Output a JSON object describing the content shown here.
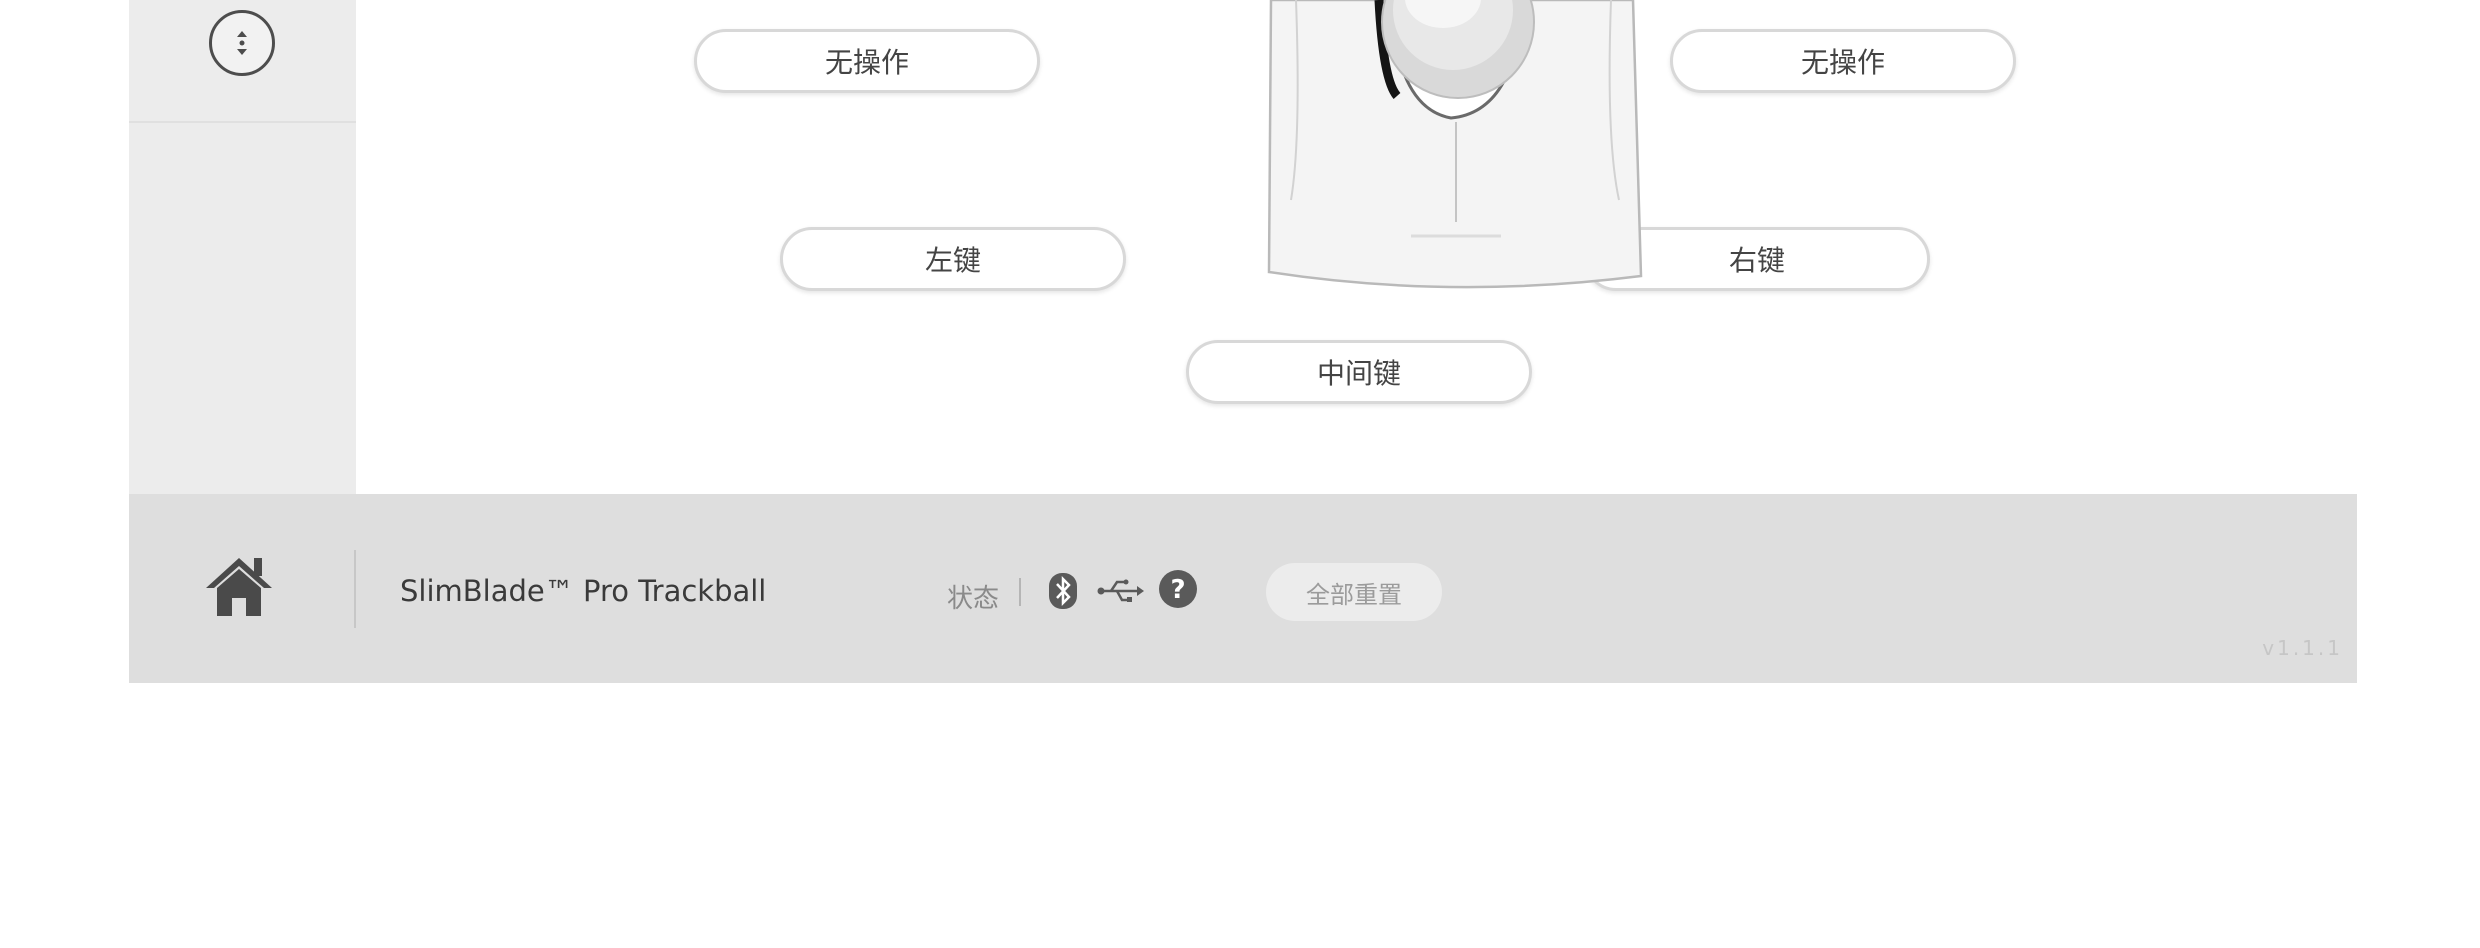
{
  "mapping": {
    "top_left": "无操作",
    "top_right": "无操作",
    "left_button": "左键",
    "right_button": "右键",
    "middle_button": "中间键"
  },
  "footer": {
    "device_name": "SlimBlade™ Pro Trackball",
    "status_label": "状态",
    "reset_all": "全部重置",
    "version": "v1.1.1"
  },
  "icons": {
    "scroll": "scroll-up-down-icon",
    "home": "home-icon",
    "bluetooth": "bluetooth-icon",
    "usb": "usb-icon",
    "help": "help-icon"
  },
  "colors": {
    "footer_bg": "#dedede",
    "sidebar_bg": "#ececec",
    "icon_dark": "#4d4d4d"
  }
}
